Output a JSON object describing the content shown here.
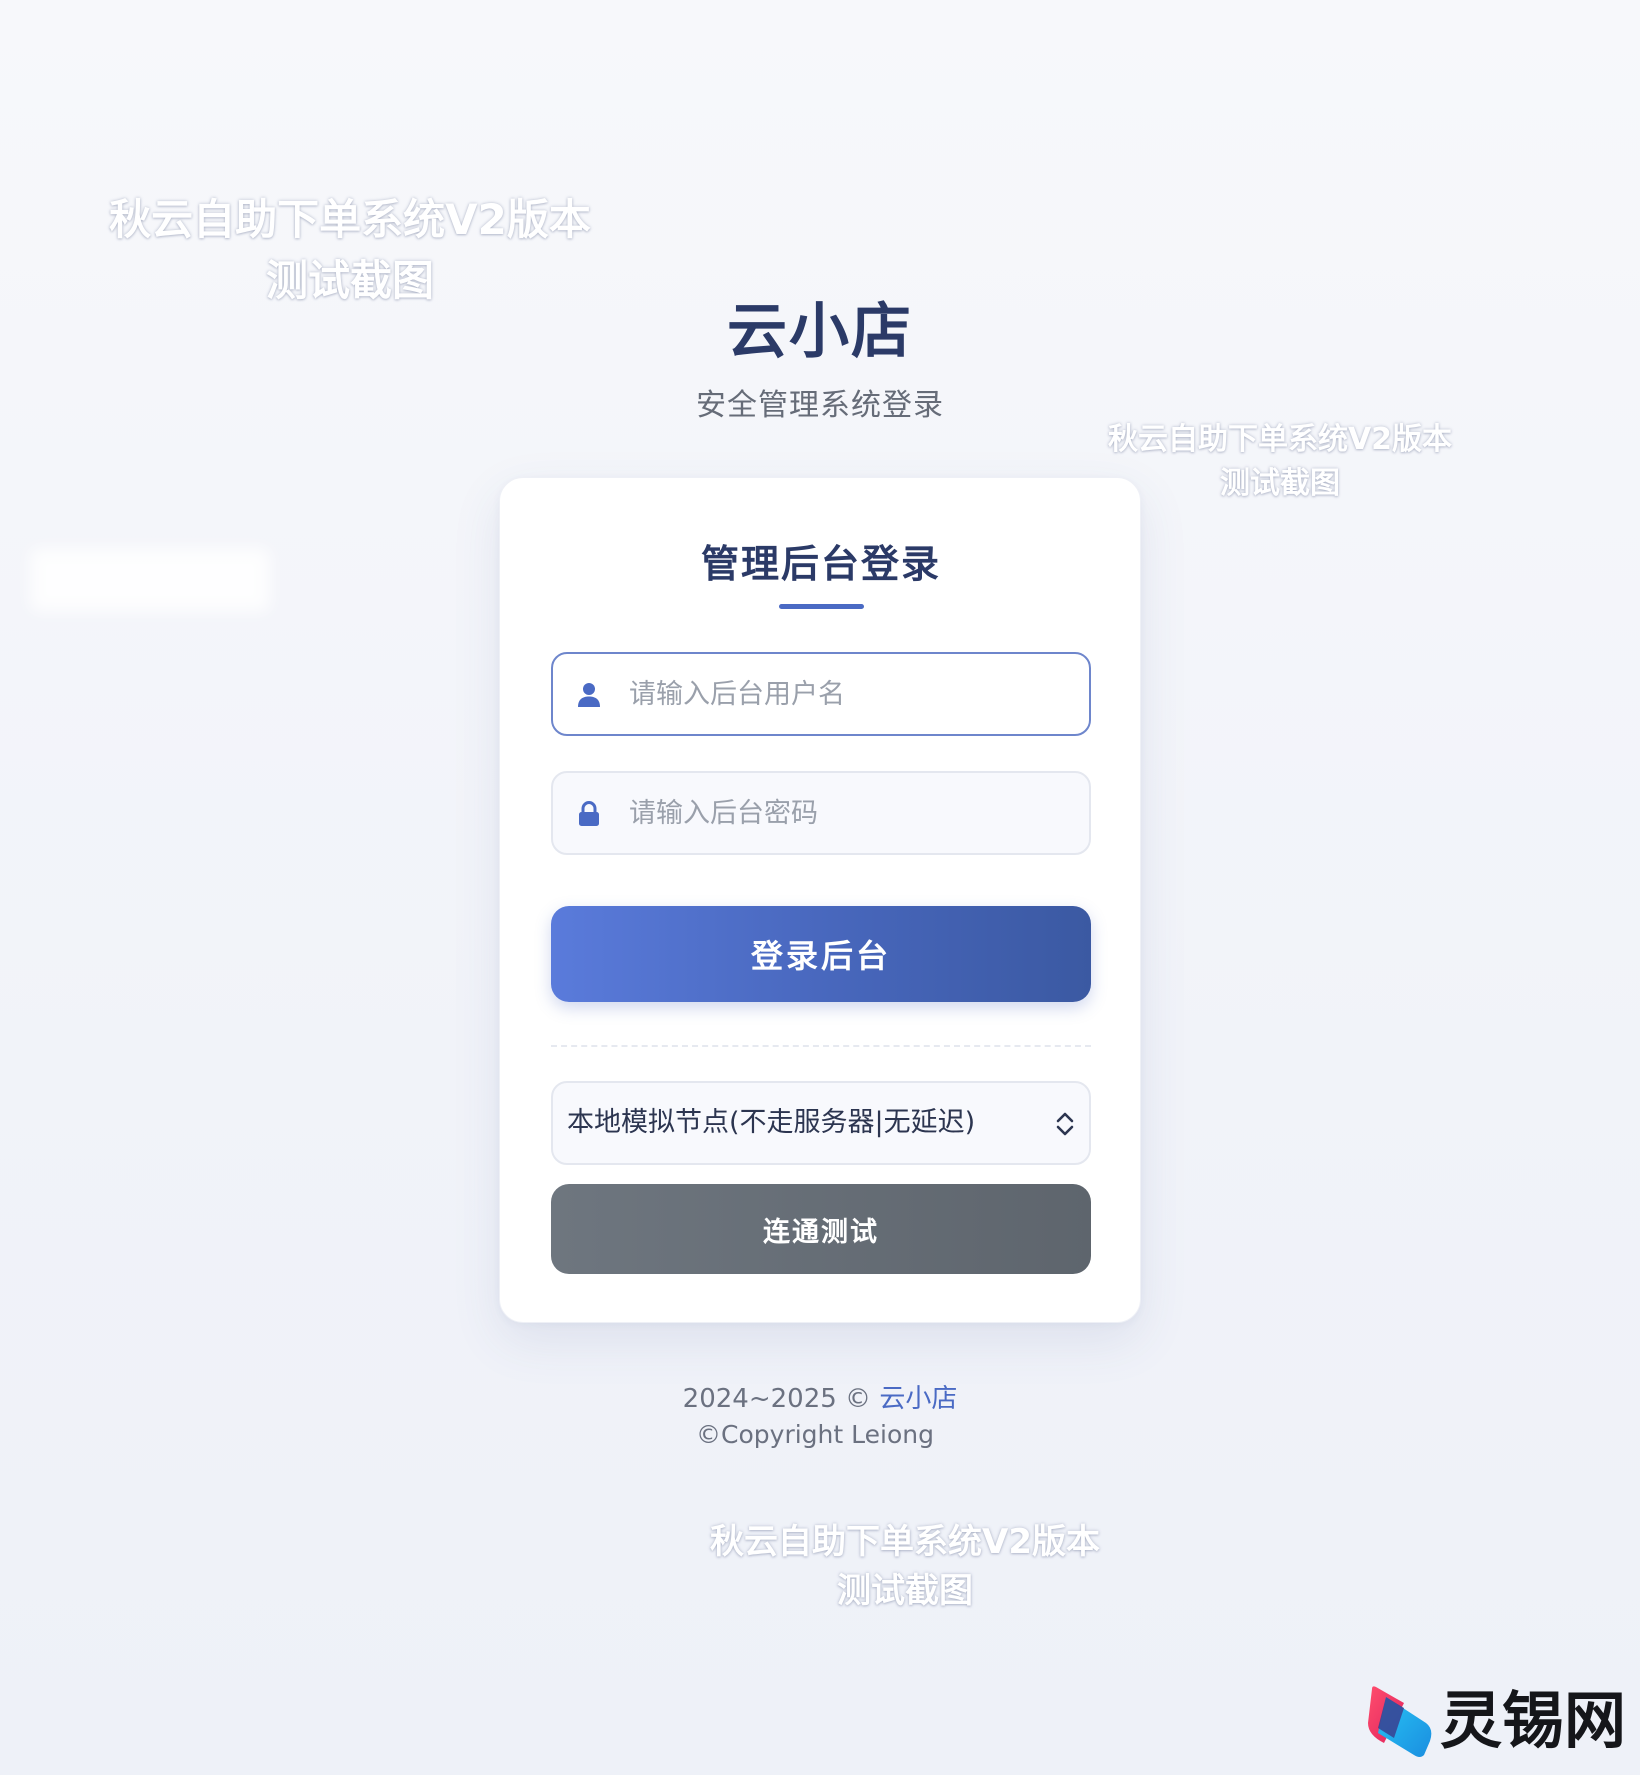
{
  "watermark": {
    "line1": "秋云自助下单系统V2版本",
    "line2": "测试截图"
  },
  "header": {
    "brand": "云小店",
    "subtitle": "安全管理系统登录"
  },
  "login_card": {
    "title": "管理后台登录",
    "username": {
      "value": "",
      "placeholder": "请输入后台用户名"
    },
    "password": {
      "value": "",
      "placeholder": "请输入后台密码"
    },
    "login_button": "登录后台",
    "node_select": {
      "selected": "本地模拟节点(不走服务器|无延迟)"
    },
    "test_button": "连通测试"
  },
  "footer": {
    "years": "2024~2025 © ",
    "brand_link": "云小店",
    "copyright": "©Copyright Leiong"
  },
  "corner_logo": {
    "text": "灵锡网"
  },
  "colors": {
    "primary": "#4a6ac4",
    "brand_text": "#2b3a67",
    "test_button": "#656d76"
  },
  "icons": {
    "username": "user-icon",
    "password": "lock-icon",
    "select": "chevron-up-down-icon"
  }
}
